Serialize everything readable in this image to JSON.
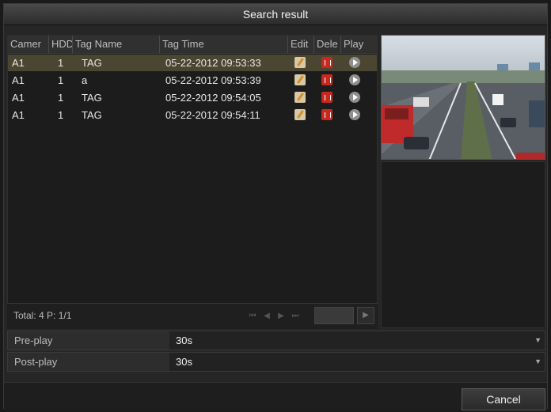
{
  "window": {
    "title": "Search result"
  },
  "table": {
    "headers": [
      "Camer",
      "HDD",
      "Tag Name",
      "Tag Time",
      "Edit",
      "Dele",
      "Play"
    ],
    "rows": [
      {
        "camera": "A1",
        "hdd": "1",
        "tag_name": "TAG",
        "tag_time": "05-22-2012 09:53:33",
        "selected": true
      },
      {
        "camera": "A1",
        "hdd": "1",
        "tag_name": "a",
        "tag_time": "05-22-2012 09:53:39",
        "selected": false
      },
      {
        "camera": "A1",
        "hdd": "1",
        "tag_name": "TAG",
        "tag_time": "05-22-2012 09:54:05",
        "selected": false
      },
      {
        "camera": "A1",
        "hdd": "1",
        "tag_name": "TAG",
        "tag_time": "05-22-2012 09:54:11",
        "selected": false
      }
    ],
    "row_icons": [
      "edit-icon",
      "delete-icon",
      "play-icon"
    ]
  },
  "footer": {
    "total_text": "Total: 4  P: 1/1"
  },
  "options": {
    "pre_play": {
      "label": "Pre-play",
      "value": "30s"
    },
    "post_play": {
      "label": "Post-play",
      "value": "30s"
    }
  },
  "buttons": {
    "cancel": "Cancel"
  },
  "colors": {
    "selected_row": "#4a4632",
    "delete_icon": "#c8281e"
  }
}
